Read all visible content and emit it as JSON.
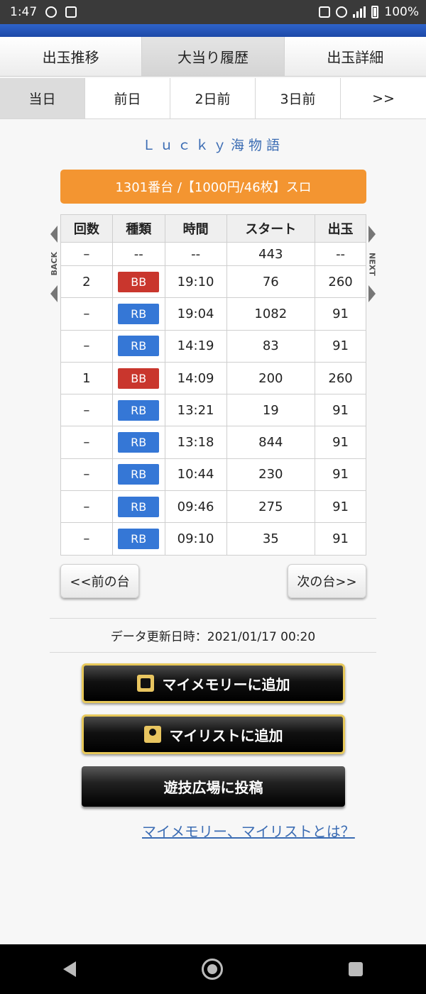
{
  "status_bar": {
    "time": "1:47",
    "battery": "100%"
  },
  "main_tabs": [
    {
      "label": "出玉推移"
    },
    {
      "label": "大当り履歴"
    },
    {
      "label": "出玉詳細"
    }
  ],
  "day_tabs": [
    {
      "label": "当日"
    },
    {
      "label": "前日"
    },
    {
      "label": "2日前"
    },
    {
      "label": "3日前"
    },
    {
      "label": ">>"
    }
  ],
  "machine_name": "Ｌｕｃｋｙ海物語",
  "unit_info": "1301番台 /【1000円/46枚】スロ",
  "side_nav": {
    "back": "BACK",
    "next": "NEXT"
  },
  "table": {
    "headers": [
      "回数",
      "種類",
      "時間",
      "スタート",
      "出玉"
    ],
    "first_row": {
      "count": "–",
      "type": "--",
      "time": "--",
      "start": "443",
      "out": "--"
    },
    "rows": [
      {
        "count": "2",
        "type": "BB",
        "time": "19:10",
        "start": "76",
        "out": "260"
      },
      {
        "count": "–",
        "type": "RB",
        "time": "19:04",
        "start": "1082",
        "out": "91"
      },
      {
        "count": "–",
        "type": "RB",
        "time": "14:19",
        "start": "83",
        "out": "91"
      },
      {
        "count": "1",
        "type": "BB",
        "time": "14:09",
        "start": "200",
        "out": "260"
      },
      {
        "count": "–",
        "type": "RB",
        "time": "13:21",
        "start": "19",
        "out": "91"
      },
      {
        "count": "–",
        "type": "RB",
        "time": "13:18",
        "start": "844",
        "out": "91"
      },
      {
        "count": "–",
        "type": "RB",
        "time": "10:44",
        "start": "230",
        "out": "91"
      },
      {
        "count": "–",
        "type": "RB",
        "time": "09:46",
        "start": "275",
        "out": "91"
      },
      {
        "count": "–",
        "type": "RB",
        "time": "09:10",
        "start": "35",
        "out": "91"
      }
    ]
  },
  "prev_button": "<<前の台",
  "next_button": "次の台>>",
  "update_text": "データ更新日時：2021/01/17 00:20",
  "my_memory_button": "マイメモリーに追加",
  "my_list_button": "マイリストに追加",
  "post_button": "遊技広場に投稿",
  "help_link": "マイメモリー、マイリストとは？",
  "colors": {
    "accent_orange": "#f39531",
    "bb_red": "#c9362d",
    "rb_blue": "#3577d6",
    "link_blue": "#3b6cb3"
  }
}
